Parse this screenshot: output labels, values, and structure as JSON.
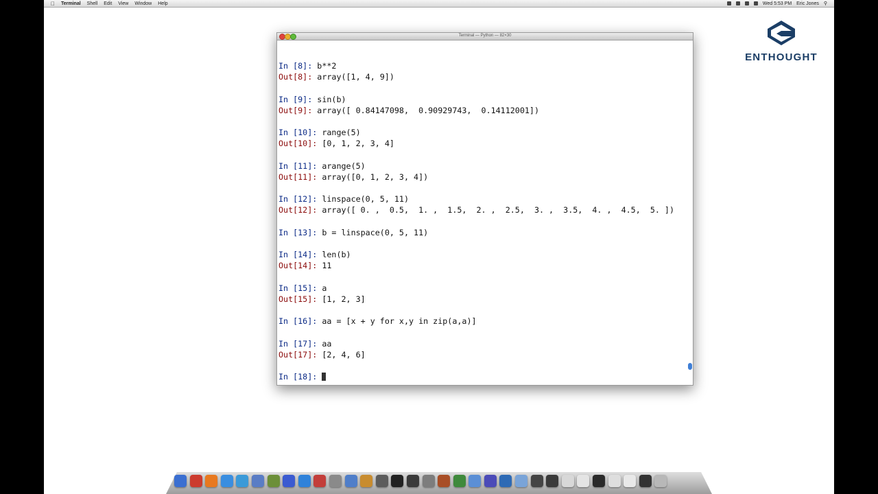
{
  "menubar": {
    "app": "Terminal",
    "items": [
      "Shell",
      "Edit",
      "View",
      "Window",
      "Help"
    ],
    "clock": "Wed 5:53 PM",
    "user": "Eric Jones"
  },
  "logo": {
    "text": "ENTHOUGHT",
    "color": "#1b3e66"
  },
  "terminal": {
    "title": "Terminal — Python — 82×30",
    "lines": [
      {
        "prompt": "In [8]: ",
        "kind": "in",
        "code": "b**2"
      },
      {
        "prompt": "Out[8]: ",
        "kind": "out",
        "code": "array([1, 4, 9])"
      },
      {
        "gap": true
      },
      {
        "prompt": "In [9]: ",
        "kind": "in",
        "code": "sin(b)"
      },
      {
        "prompt": "Out[9]: ",
        "kind": "out",
        "code": "array([ 0.84147098,  0.90929743,  0.14112001])"
      },
      {
        "gap": true
      },
      {
        "prompt": "In [10]: ",
        "kind": "in",
        "code": "range(5)"
      },
      {
        "prompt": "Out[10]: ",
        "kind": "out",
        "code": "[0, 1, 2, 3, 4]"
      },
      {
        "gap": true
      },
      {
        "prompt": "In [11]: ",
        "kind": "in",
        "code": "arange(5)"
      },
      {
        "prompt": "Out[11]: ",
        "kind": "out",
        "code": "array([0, 1, 2, 3, 4])"
      },
      {
        "gap": true
      },
      {
        "prompt": "In [12]: ",
        "kind": "in",
        "code": "linspace(0, 5, 11)"
      },
      {
        "prompt": "Out[12]: ",
        "kind": "out",
        "code": "array([ 0. ,  0.5,  1. ,  1.5,  2. ,  2.5,  3. ,  3.5,  4. ,  4.5,  5. ])"
      },
      {
        "gap": true
      },
      {
        "prompt": "In [13]: ",
        "kind": "in",
        "code": "b = linspace(0, 5, 11)"
      },
      {
        "gap": true
      },
      {
        "prompt": "In [14]: ",
        "kind": "in",
        "code": "len(b)"
      },
      {
        "prompt": "Out[14]: ",
        "kind": "out",
        "code": "11"
      },
      {
        "gap": true
      },
      {
        "prompt": "In [15]: ",
        "kind": "in",
        "code": "a"
      },
      {
        "prompt": "Out[15]: ",
        "kind": "out",
        "code": "[1, 2, 3]"
      },
      {
        "gap": true
      },
      {
        "prompt": "In [16]: ",
        "kind": "in",
        "code": "aa = [x + y for x,y in zip(a,a)]"
      },
      {
        "gap": true
      },
      {
        "prompt": "In [17]: ",
        "kind": "in",
        "code": "aa"
      },
      {
        "prompt": "Out[17]: ",
        "kind": "out",
        "code": "[2, 4, 6]"
      },
      {
        "gap": true
      },
      {
        "prompt": "In [18]: ",
        "kind": "in",
        "code": "",
        "cursor": true
      }
    ]
  },
  "dock": {
    "icons": [
      "finder-icon",
      "activity-monitor-icon",
      "firefox-icon",
      "mail-icon",
      "safari-icon",
      "preview-icon",
      "textmate-icon",
      "itunes-icon",
      "ichat-icon",
      "ical-icon",
      "system-preferences-icon",
      "music-icon",
      "photo-icon",
      "gimp-icon",
      "terminal-icon",
      "dashboard-icon",
      "disk-utility-icon",
      "firewire-icon",
      "calculator-icon",
      "finder-2-icon",
      "xcode-icon",
      "iphoto-icon",
      "mail-2-icon",
      "archive-icon",
      "camera-icon",
      "document-icon",
      "document-2-icon",
      "display-icon",
      "document-3-icon",
      "document-4-icon",
      "display-2-icon",
      "trash-icon"
    ],
    "colors": [
      "#3b6fd1",
      "#cc3b2e",
      "#e8791f",
      "#3a8ee0",
      "#3b9ad8",
      "#5a7dc5",
      "#6c8f39",
      "#3b5bd1",
      "#2f82da",
      "#c33e3a",
      "#8a8a8a",
      "#4f7ec9",
      "#c88c2f",
      "#5c5c5c",
      "#222222",
      "#3a3a3a",
      "#7d7d7d",
      "#a84e26",
      "#3f8a3c",
      "#5b8fd6",
      "#4b4bb8",
      "#2d6ab5",
      "#7aa4d8",
      "#444444",
      "#3a3a3a",
      "#d8d8d8",
      "#e4e4e4",
      "#2a2a2a",
      "#dedede",
      "#e8e8e8",
      "#333333",
      "#b8b8b8"
    ]
  }
}
